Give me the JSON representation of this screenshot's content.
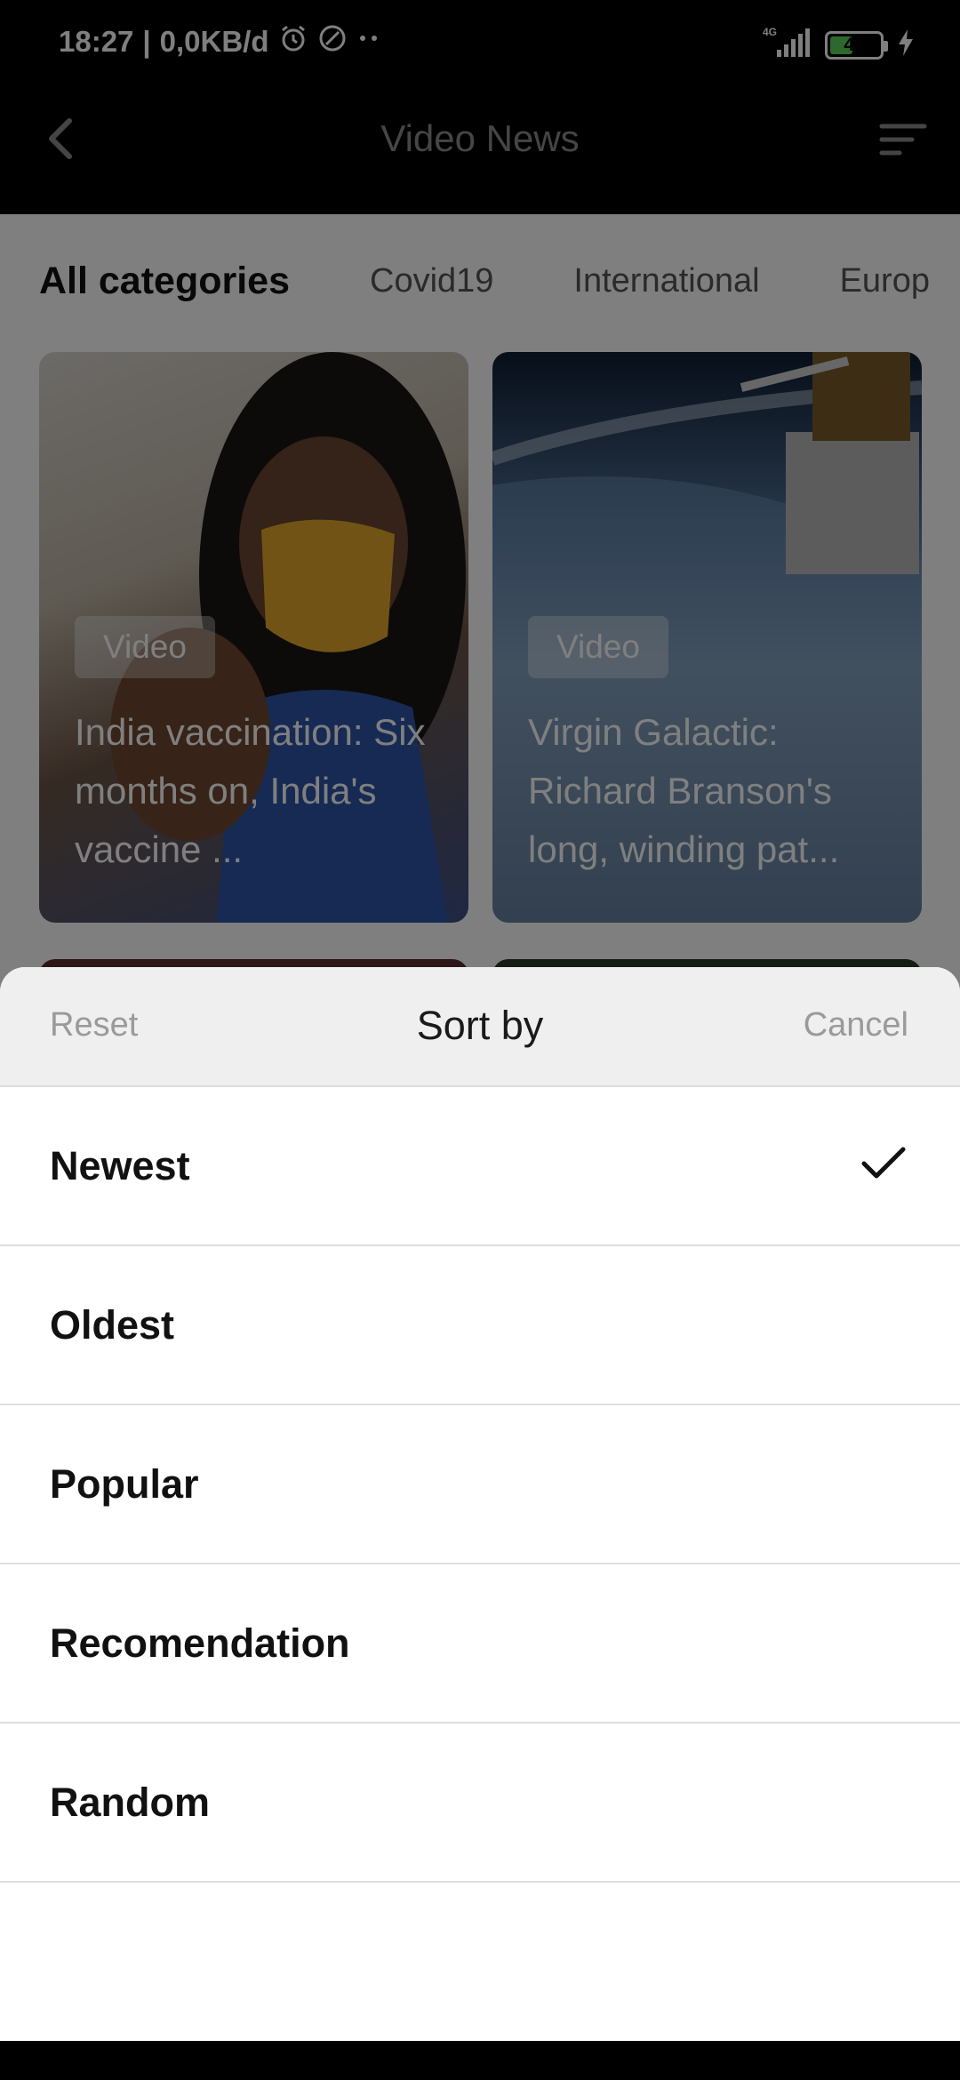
{
  "status_bar": {
    "time": "18:27",
    "speed": "0,0KB/d",
    "network": "4G",
    "battery": "47",
    "battery_level": 0.47
  },
  "header": {
    "title": "Video News"
  },
  "categories": [
    "All categories",
    "Covid19",
    "International",
    "Europ"
  ],
  "cards": [
    {
      "badge": "Video",
      "title": "India vaccination: Six months on, India's vaccine ..."
    },
    {
      "badge": "Video",
      "title": "Virgin Galactic: Richard Branson's long, winding pat..."
    }
  ],
  "sort_sheet": {
    "reset_label": "Reset",
    "title": "Sort by",
    "cancel_label": "Cancel",
    "options": [
      {
        "label": "Newest",
        "selected": true
      },
      {
        "label": "Oldest",
        "selected": false
      },
      {
        "label": "Popular",
        "selected": false
      },
      {
        "label": "Recomendation",
        "selected": false
      },
      {
        "label": "Random",
        "selected": false
      }
    ]
  },
  "icons": {
    "back": "back-arrow-icon",
    "filter": "sort-filter-icon",
    "check": "checkmark-icon",
    "alarm": "alarm-icon",
    "signal": "signal-icon",
    "battery": "battery-icon",
    "charging": "charging-bolt-icon"
  },
  "colors": {
    "accent_check": "#111111",
    "battery_fill": "#5bd15b"
  }
}
